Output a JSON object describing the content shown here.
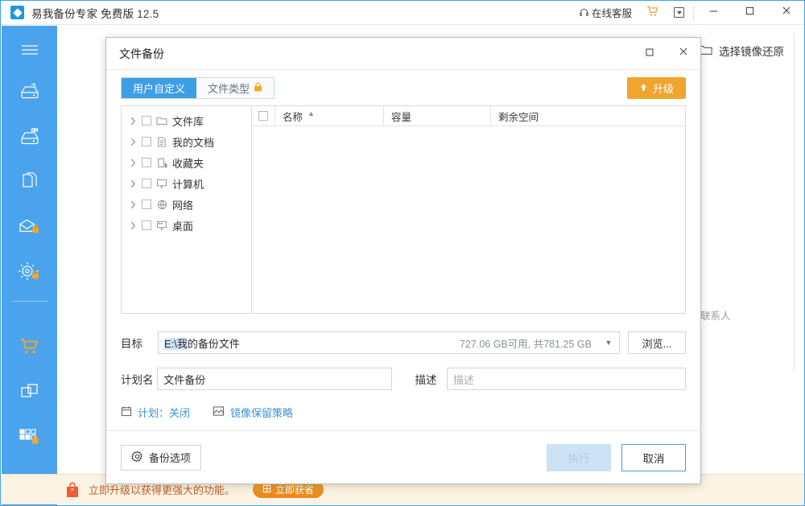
{
  "window": {
    "app_name": "易我备份专家",
    "edition": "免费版",
    "version": "12.5",
    "logo_icon": "easeus-diamond-icon",
    "support_label": "在线客服",
    "support_icon": "headset-icon",
    "cart_icon": "shopping-cart-icon",
    "tray_icon": "dropdown-box-icon",
    "minimize_icon": "minimize-icon",
    "maximize_icon": "maximize-icon",
    "close_icon": "close-icon"
  },
  "sidebar": {
    "items": [
      {
        "name": "menu",
        "icon": "hamburger-menu-icon",
        "locked": false
      },
      {
        "name": "disk-backup",
        "icon": "disk-backup-icon",
        "locked": false
      },
      {
        "name": "system-backup",
        "icon": "system-backup-icon",
        "locked": false
      },
      {
        "name": "file-backup",
        "icon": "file-backup-icon",
        "locked": false
      },
      {
        "name": "mail-backup",
        "icon": "mail-backup-icon",
        "locked": true
      },
      {
        "name": "smart-backup",
        "icon": "smart-backup-icon",
        "locked": true
      },
      {
        "name": "purchase",
        "icon": "shopping-cart-icon",
        "locked": false
      },
      {
        "name": "clone",
        "icon": "clone-icon",
        "locked": false
      },
      {
        "name": "tools-apps",
        "icon": "apps-grid-icon",
        "locked": true
      },
      {
        "name": "utilities",
        "icon": "wrench-icon",
        "locked": false
      }
    ]
  },
  "background": {
    "restore_label": "选择镜像还原",
    "restore_icon": "folder-icon",
    "contact_label": "联系人"
  },
  "promo": {
    "icon": "gift-bag-icon",
    "text": "立即升级以获得更强大的功能。",
    "button_label": "立即获省",
    "button_icon": "upgrade-box-icon"
  },
  "dialog": {
    "title": "文件备份",
    "maximize_icon": "maximize-icon",
    "close_icon": "close-icon",
    "tabs": [
      {
        "label": "用户自定义",
        "active": true,
        "locked": false
      },
      {
        "label": "文件类型",
        "active": false,
        "locked": true,
        "lock_icon": "lock-icon"
      }
    ],
    "upgrade_button": {
      "label": "升级",
      "icon": "arrow-up-icon"
    },
    "tree": {
      "items": [
        {
          "label": "文件库",
          "icon": "library-folder-icon"
        },
        {
          "label": "我的文档",
          "icon": "document-icon"
        },
        {
          "label": "收藏夹",
          "icon": "favorites-icon"
        },
        {
          "label": "计算机",
          "icon": "computer-icon"
        },
        {
          "label": "网络",
          "icon": "network-icon"
        },
        {
          "label": "桌面",
          "icon": "desktop-icon"
        }
      ]
    },
    "list": {
      "columns": [
        "名称",
        "容量",
        "剩余空间"
      ],
      "sort_column": "名称",
      "sort_direction": "asc",
      "rows": []
    },
    "destination": {
      "label": "目标",
      "value": "E:\\我的备份文件",
      "selected_text": "E:\\我",
      "remaining_text": "的备份文件",
      "space_info": "727.06 GB可用, 共781.25 GB",
      "browse_label": "浏览...",
      "dropdown_icon": "chevron-down-icon"
    },
    "plan": {
      "label": "计划名",
      "value": "文件备份"
    },
    "description": {
      "label": "描述",
      "placeholder": "描述",
      "value": ""
    },
    "links": [
      {
        "label": "计划：关闭",
        "icon": "calendar-icon"
      },
      {
        "label": "镜像保留策略",
        "icon": "image-policy-icon"
      }
    ],
    "footer": {
      "options_label": "备份选项",
      "options_icon": "gear-icon",
      "execute_label": "执行",
      "execute_disabled": true,
      "cancel_label": "取消"
    }
  },
  "colors": {
    "brand_blue": "#4aa3ec",
    "accent_orange": "#f0a52e",
    "tab_active": "#3e9ee5",
    "disabled_blue": "#cde3f5",
    "promo_bg": "#fdf3e2"
  }
}
